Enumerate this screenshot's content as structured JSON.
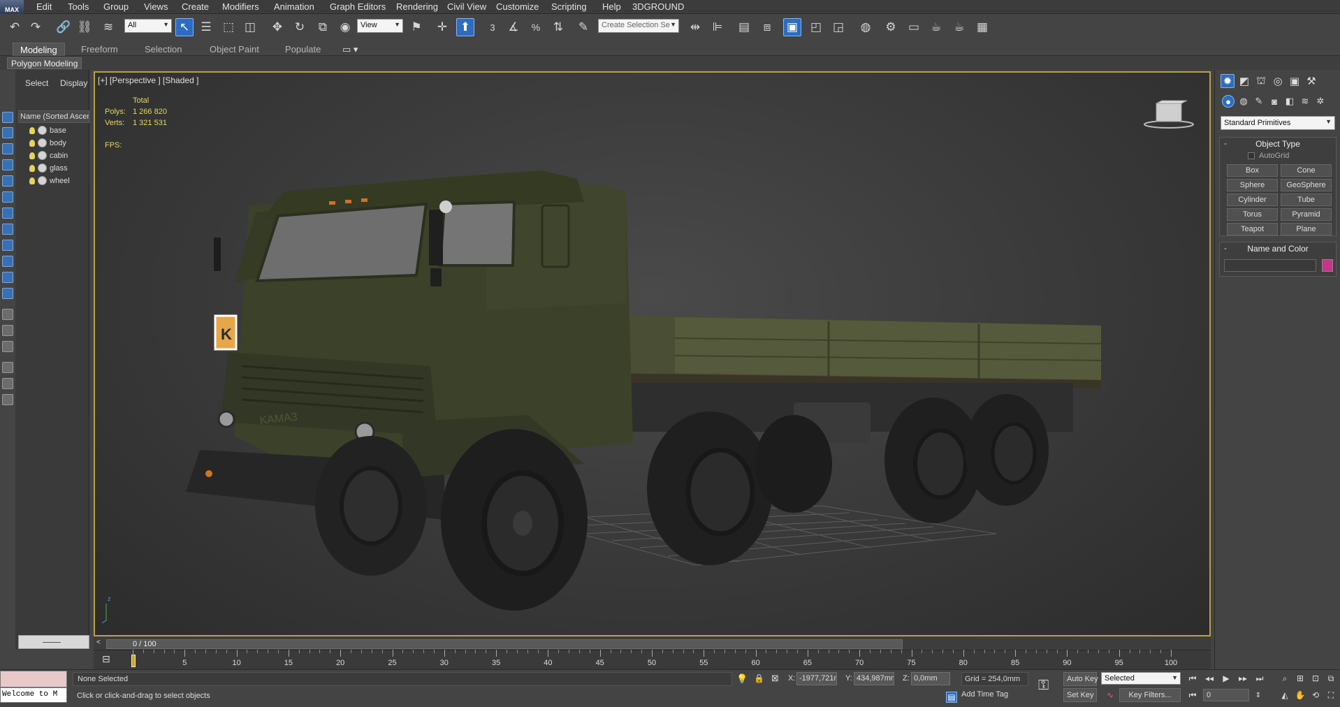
{
  "menu": {
    "logo": "MAX",
    "items": [
      "Edit",
      "Tools",
      "Group",
      "Views",
      "Create",
      "Modifiers",
      "Animation",
      "Graph Editors",
      "Rendering",
      "Civil View",
      "Customize",
      "Scripting",
      "Help",
      "3DGROUND"
    ]
  },
  "toolbar": {
    "filter_value": "All",
    "ref_coord_value": "View",
    "snap_label": "3",
    "percent_label": "%",
    "named_selection_placeholder": "Create Selection Se"
  },
  "ribbon": {
    "tabs": [
      "Modeling",
      "Freeform",
      "Selection",
      "Object Paint",
      "Populate"
    ],
    "active_tab": "Modeling",
    "panel_label": "Polygon Modeling"
  },
  "scene_explorer": {
    "tabs": [
      "Select",
      "Display"
    ],
    "column_header": "Name (Sorted Ascending)",
    "objects": [
      "base",
      "body",
      "cabin",
      "glass",
      "wheel"
    ]
  },
  "viewport": {
    "label": "[+] [Perspective ] [Shaded ]",
    "stats": {
      "total_label": "Total",
      "polys_label": "Polys:",
      "polys_value": "1 266 820",
      "verts_label": "Verts:",
      "verts_value": "1 321 531",
      "fps_label": "FPS:"
    }
  },
  "command_panel": {
    "primitive_type": "Standard Primitives",
    "object_type_title": "Object Type",
    "autogrid_label": "AutoGrid",
    "buttons": [
      "Box",
      "Cone",
      "Sphere",
      "GeoSphere",
      "Cylinder",
      "Tube",
      "Torus",
      "Pyramid",
      "Teapot",
      "Plane"
    ],
    "name_color_title": "Name and Color",
    "color": "#c8338c"
  },
  "timeline": {
    "frame_label": "0 / 100",
    "tick_labels": [
      "0",
      "5",
      "10",
      "15",
      "20",
      "25",
      "30",
      "35",
      "40",
      "45",
      "50",
      "55",
      "60",
      "65",
      "70",
      "75",
      "80",
      "85",
      "90",
      "95",
      "100"
    ]
  },
  "status": {
    "listener_text": "Welcome to M",
    "selection_status": "None Selected",
    "prompt": "Click or click-and-drag to select objects",
    "x_label": "X:",
    "x_value": "-1977,721n",
    "y_label": "Y:",
    "y_value": "434,987mm",
    "z_label": "Z:",
    "z_value": "0,0mm",
    "grid": "Grid = 254,0mm",
    "add_time_tag": "Add Time Tag",
    "auto_key": "Auto Key",
    "set_key": "Set Key",
    "selected_value": "Selected",
    "key_filters": "Key Filters...",
    "frame_value": "0"
  },
  "colors": {
    "accent": "#2d6cbf",
    "viewport_border": "#b7a146",
    "stats_text": "#e6d860"
  }
}
